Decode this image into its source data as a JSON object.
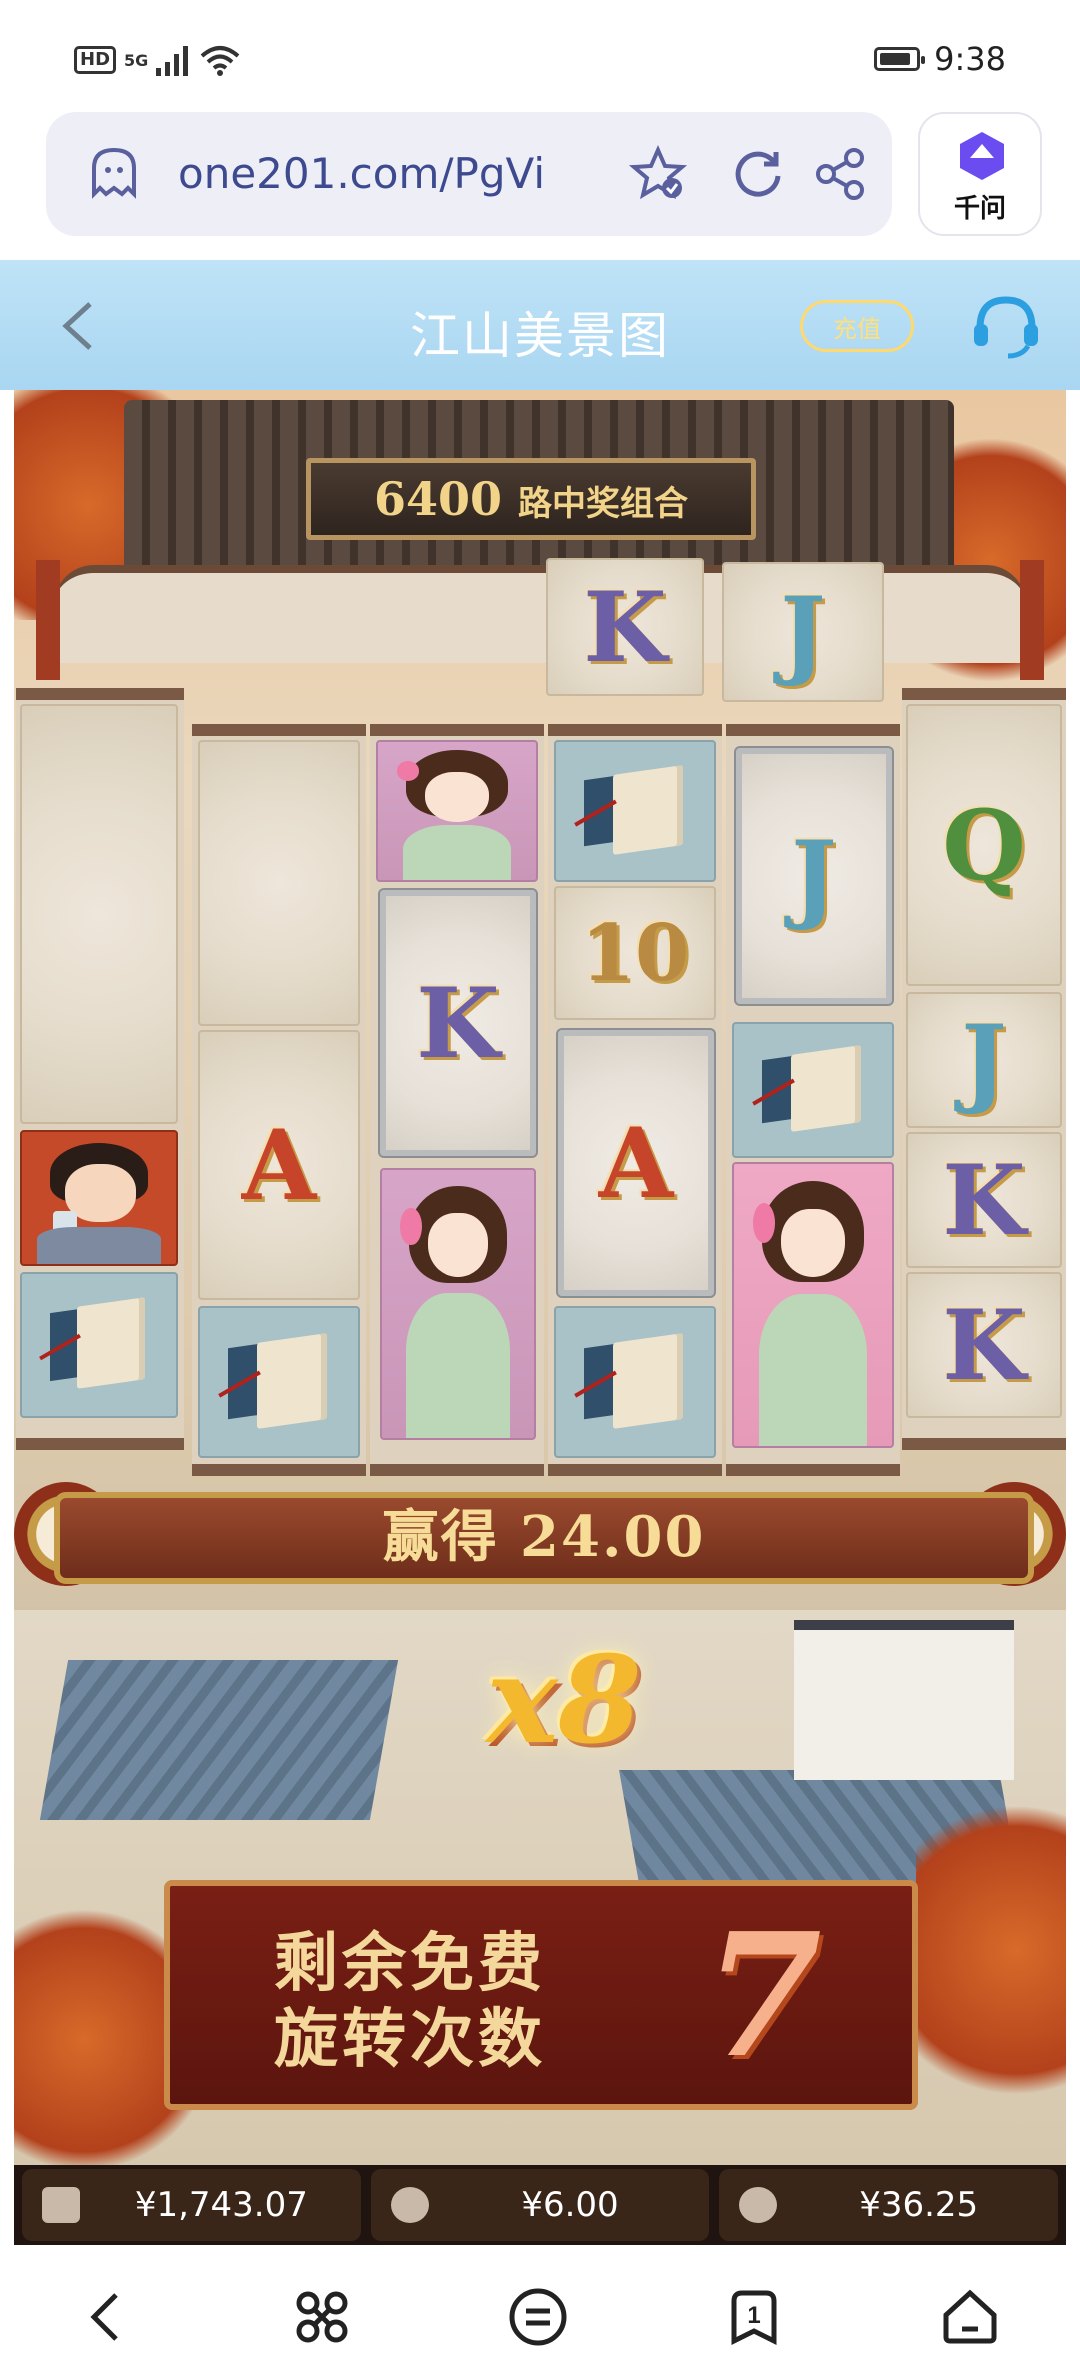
{
  "status_bar": {
    "network": "HD",
    "signal": "5G",
    "time": "9:38"
  },
  "browser": {
    "url": "one201.com/PgVi",
    "assistant_label": "千问"
  },
  "app_header": {
    "title": "江山美景图",
    "recharge_label": "充值"
  },
  "game": {
    "ways_banner": {
      "number": "6400",
      "text": "路中奖组合"
    },
    "win_label": "赢得 24.00",
    "multiplier": "x8",
    "free_spins": {
      "label_line1": "剩余免费",
      "label_line2": "旋转次数",
      "count": "7"
    }
  },
  "stats": {
    "balance": "¥1,743.07",
    "bet": "¥6.00",
    "win": "¥36.25"
  },
  "top_row_symbols": [
    "K",
    "J"
  ],
  "reels": [
    [
      "blank",
      "man",
      "book"
    ],
    [
      "blank",
      "A",
      "book"
    ],
    [
      "girl",
      "K",
      "girl"
    ],
    [
      "book",
      "10",
      "A",
      "book"
    ],
    [
      "J",
      "book",
      "girl"
    ],
    [
      "Q",
      "J",
      "K",
      "K"
    ]
  ],
  "colors": {
    "header_bg": "#a9d6f1",
    "win_gold": "#f6dc96",
    "stat_bg": "#3a2619"
  }
}
